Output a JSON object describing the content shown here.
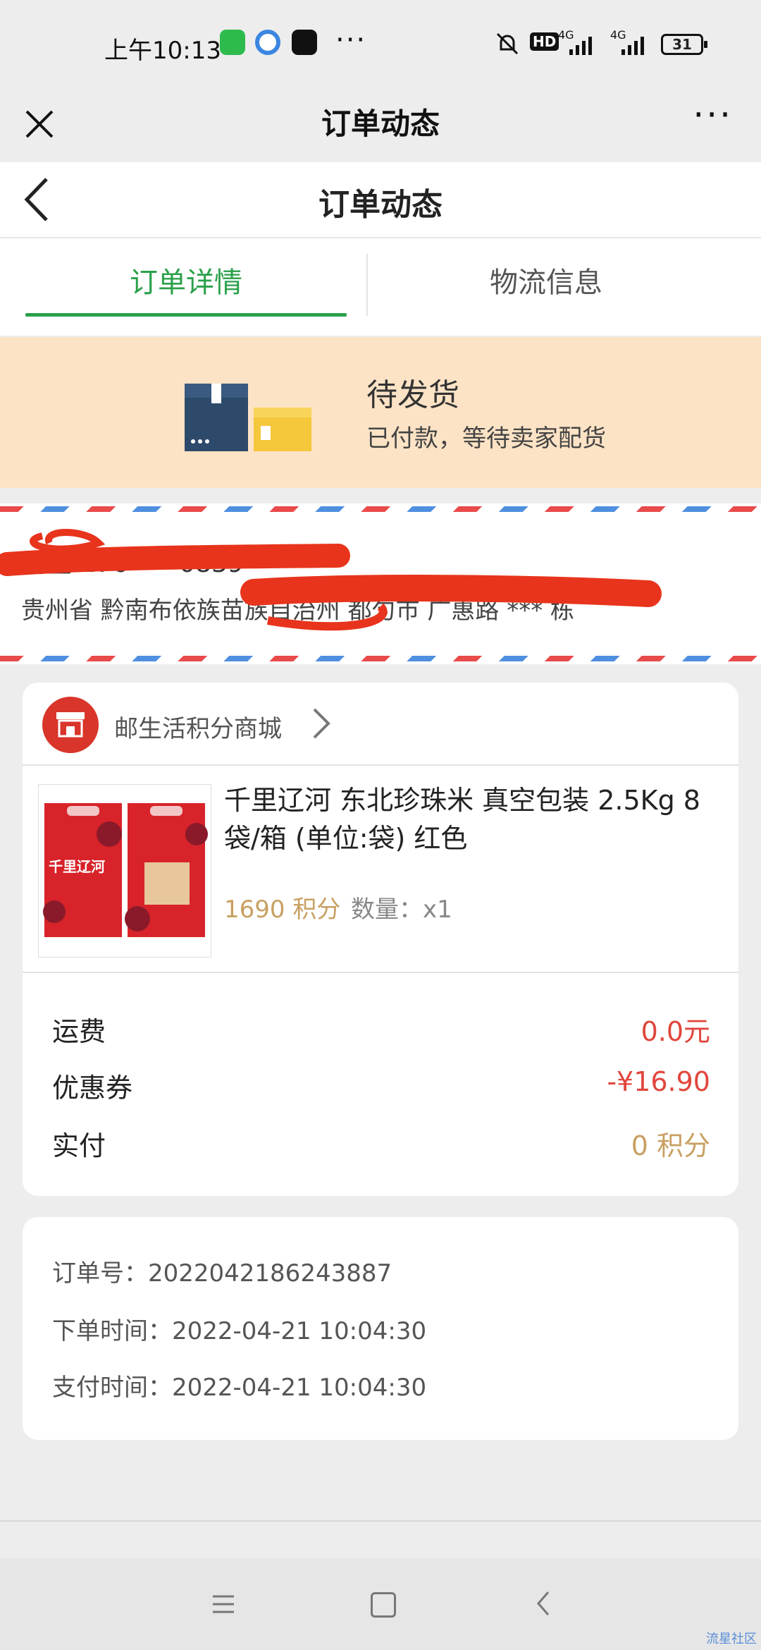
{
  "status_bar": {
    "time": "上午10:13",
    "more": "···",
    "hd": "HD",
    "net1": "4G",
    "net2": "4G",
    "battery": "31"
  },
  "wechat_bar": {
    "title": "订单动态",
    "close": "✕",
    "more": "···"
  },
  "header": {
    "title": "订单动态"
  },
  "tabs": [
    {
      "label": "订单详情",
      "active": true
    },
    {
      "label": "物流信息",
      "active": false
    }
  ],
  "order_status": {
    "title": "待发货",
    "subtitle": "已付款，等待卖家配货"
  },
  "address": {
    "name_line": "刘星 176****0839",
    "address_line": "贵州省 黔南布依族苗族自治州 都匀市 广惠路 *** 栋"
  },
  "shop": {
    "name": "邮生活积分商城"
  },
  "product": {
    "name": "千里辽河 东北珍珠米 真空包装 2.5Kg 8袋/箱 (单位:袋) 红色",
    "price": "1690 积分",
    "quantity": "数量：x1",
    "image_text": "千里辽河"
  },
  "costs": {
    "shipping_label": "运费",
    "shipping_value": "0.0元",
    "coupon_label": "优惠券",
    "coupon_value": "-¥16.90",
    "paid_label": "实付",
    "paid_value": "0 积分"
  },
  "order_info": {
    "order_no": "订单号：2022042186243887",
    "created": "下单时间：2022-04-21 10:04:30",
    "paid": "支付时间：2022-04-21 10:04:30"
  },
  "watermark": "流星社区",
  "colors": {
    "accent_green": "#2aa04a",
    "banner_bg": "#fde3c5",
    "price_gold": "#c9a062",
    "price_red": "#e0463c",
    "shop_red": "#d9352a"
  }
}
